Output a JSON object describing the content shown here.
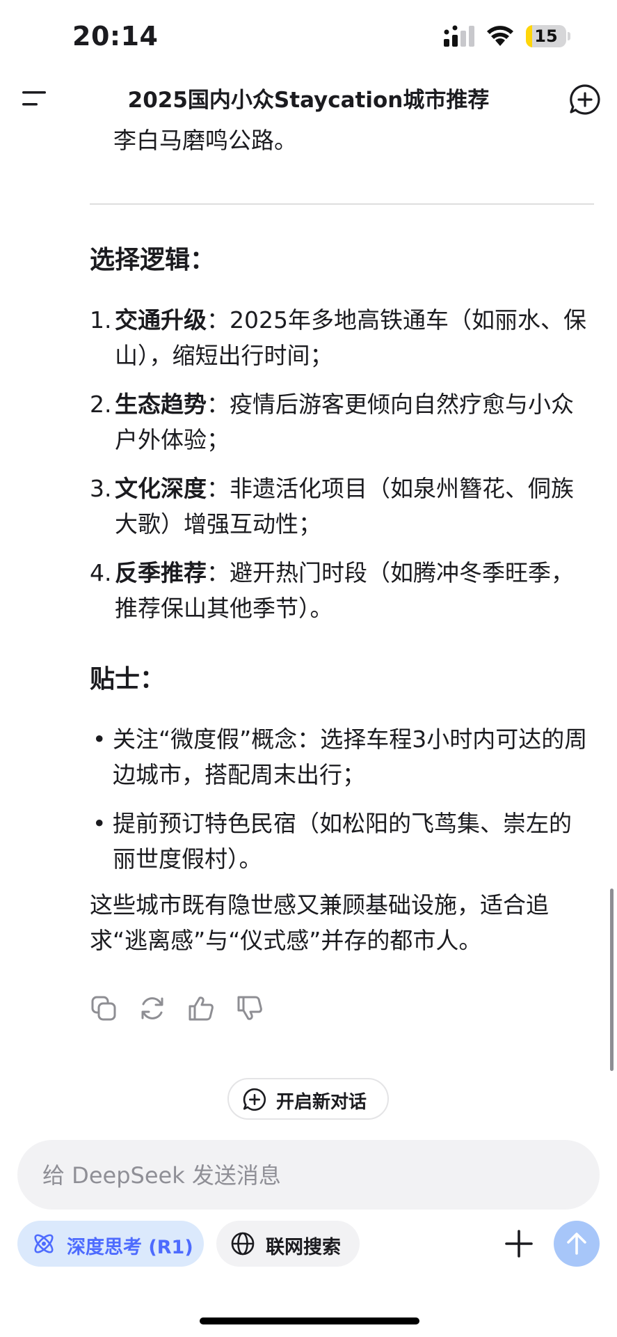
{
  "status_bar": {
    "time": "20:14",
    "battery_level": "15",
    "battery_fraction": 0.15,
    "battery_color": "#ffd60a",
    "icons": [
      "signal-icon",
      "wifi-icon",
      "battery-icon"
    ]
  },
  "header": {
    "title": "2025国内小众Staycation城市推荐",
    "menu_icon": "menu-icon",
    "new_chat_icon": "new-chat-icon"
  },
  "content": {
    "cut_text": "李白马磨鸣公路。",
    "selection": {
      "heading": "选择逻辑：",
      "items": [
        {
          "num": "1.",
          "bold": "交通升级",
          "text": "：2025年多地高铁通车（如丽水、保山），缩短出行时间；"
        },
        {
          "num": "2.",
          "bold": "生态趋势",
          "text": "：疫情后游客更倾向自然疗愈与小众户外体验；"
        },
        {
          "num": "3.",
          "bold": "文化深度",
          "text": "：非遗活化项目（如泉州簪花、侗族大歌）增强互动性；"
        },
        {
          "num": "4.",
          "bold": "反季推荐",
          "text": "：避开热门时段（如腾冲冬季旺季，推荐保山其他季节）。"
        }
      ]
    },
    "tips": {
      "heading": "贴士：",
      "items": [
        {
          "bullet": "•",
          "text": "关注“微度假”概念：选择车程3小时内可达的周边城市，搭配周末出行；"
        },
        {
          "bullet": "•",
          "text": "提前预订特色民宿（如松阳的飞茑集、崇左的丽世度假村）。"
        }
      ]
    },
    "closing": "这些城市既有隐世感又兼顾基础设施，适合追求“逃离感”与“仪式感”并存的都市人。",
    "actions": [
      "copy-icon",
      "regenerate-icon",
      "thumbs-up-icon",
      "thumbs-down-icon"
    ],
    "new_chat_label": "开启新对话"
  },
  "composer": {
    "placeholder": "给 DeepSeek 发送消息",
    "value": "",
    "deep_think_label": "深度思考 (R1)",
    "web_search_label": "联网搜索",
    "accent_color": "#4d6bfe",
    "send_color": "#a7c6f9"
  }
}
